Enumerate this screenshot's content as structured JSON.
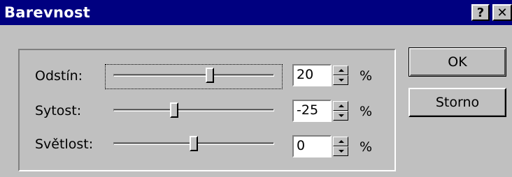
{
  "window": {
    "title": "Barevnost",
    "help_label": "?",
    "close_label": "✕"
  },
  "rows": [
    {
      "label": "Odstín:",
      "value": "20",
      "unit": "%",
      "slider_fraction": 0.6
    },
    {
      "label": "Sytost:",
      "value": "-25",
      "unit": "%",
      "slider_fraction": 0.38
    },
    {
      "label": "Světlost:",
      "value": "0",
      "unit": "%",
      "slider_fraction": 0.5
    }
  ],
  "buttons": {
    "ok_label": "OK",
    "cancel_label": "Storno"
  }
}
